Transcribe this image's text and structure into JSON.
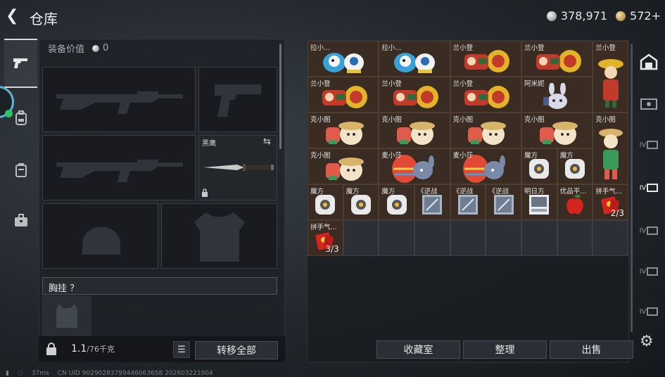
{
  "header": {
    "title": "仓库",
    "silver": "378,971",
    "gold": "572+"
  },
  "equipment": {
    "value_label": "装备价值",
    "value": "0",
    "knife_label": "黑鹰",
    "chest_label": "胸挂 ？",
    "weight_value": "1.1",
    "weight_unit": "/76千克",
    "transfer_label": "转移全部"
  },
  "warehouse": {
    "items": [
      {
        "label": "拉小...",
        "art": "bird",
        "count": ""
      },
      {
        "label": "拉小...",
        "art": "bird",
        "count": ""
      },
      {
        "label": "兰小登",
        "art": "mexican",
        "count": ""
      },
      {
        "label": "兰小登",
        "art": "mexican",
        "count": ""
      },
      {
        "label": "兰小登",
        "art": "mexican-tall",
        "count": ""
      },
      {
        "label": "兰小登",
        "art": "mexican",
        "count": ""
      },
      {
        "label": "兰小登",
        "art": "mexican",
        "count": ""
      },
      {
        "label": "兰小登",
        "art": "mexican",
        "count": ""
      },
      {
        "label": "阿米妮",
        "art": "bunny",
        "count": ""
      },
      {
        "label": "克小图",
        "art": "explorer",
        "count": ""
      },
      {
        "label": "克小图",
        "art": "explorer",
        "count": ""
      },
      {
        "label": "克小图",
        "art": "explorer",
        "count": ""
      },
      {
        "label": "克小图",
        "art": "explorer",
        "count": ""
      },
      {
        "label": "克小图",
        "art": "explorer-tall",
        "count": ""
      },
      {
        "label": "克小图",
        "art": "explorer",
        "count": ""
      },
      {
        "label": "麦小莎",
        "art": "egg",
        "count": ""
      },
      {
        "label": "麦小莎",
        "art": "egg",
        "count": ""
      },
      {
        "label": "魔方",
        "art": "cube",
        "count": ""
      },
      {
        "label": "魔方",
        "art": "cube",
        "count": ""
      },
      {
        "label": "魔方",
        "art": "cube",
        "count": ""
      },
      {
        "label": "魔方",
        "art": "cube",
        "count": ""
      },
      {
        "label": "魔方",
        "art": "cube",
        "count": ""
      },
      {
        "label": "《逆战",
        "art": "card",
        "count": ""
      },
      {
        "label": "《逆战",
        "art": "card",
        "count": ""
      },
      {
        "label": "《逆战",
        "art": "card",
        "count": ""
      },
      {
        "label": "明日方",
        "art": "book",
        "count": ""
      },
      {
        "label": "优品平...",
        "art": "apple",
        "count": ""
      },
      {
        "label": "拼手气...",
        "art": "redpacket",
        "count": "2/3"
      },
      {
        "label": "拼手气...",
        "art": "redpacket",
        "count": "3/3"
      }
    ],
    "buttons": {
      "collection": "收藏室",
      "sort": "整理",
      "sell": "出售"
    }
  },
  "right_tabs": [
    "IV",
    "IV",
    "IV",
    "IV",
    "IV",
    "IV"
  ],
  "status": {
    "ping": "37ms",
    "uid": "CN UID 902902837994460636S8 202603221904"
  },
  "colors": {
    "item_bg": "#3a2c22",
    "accent_ring": "#5fb3d3",
    "online_dot": "#29c46a"
  }
}
